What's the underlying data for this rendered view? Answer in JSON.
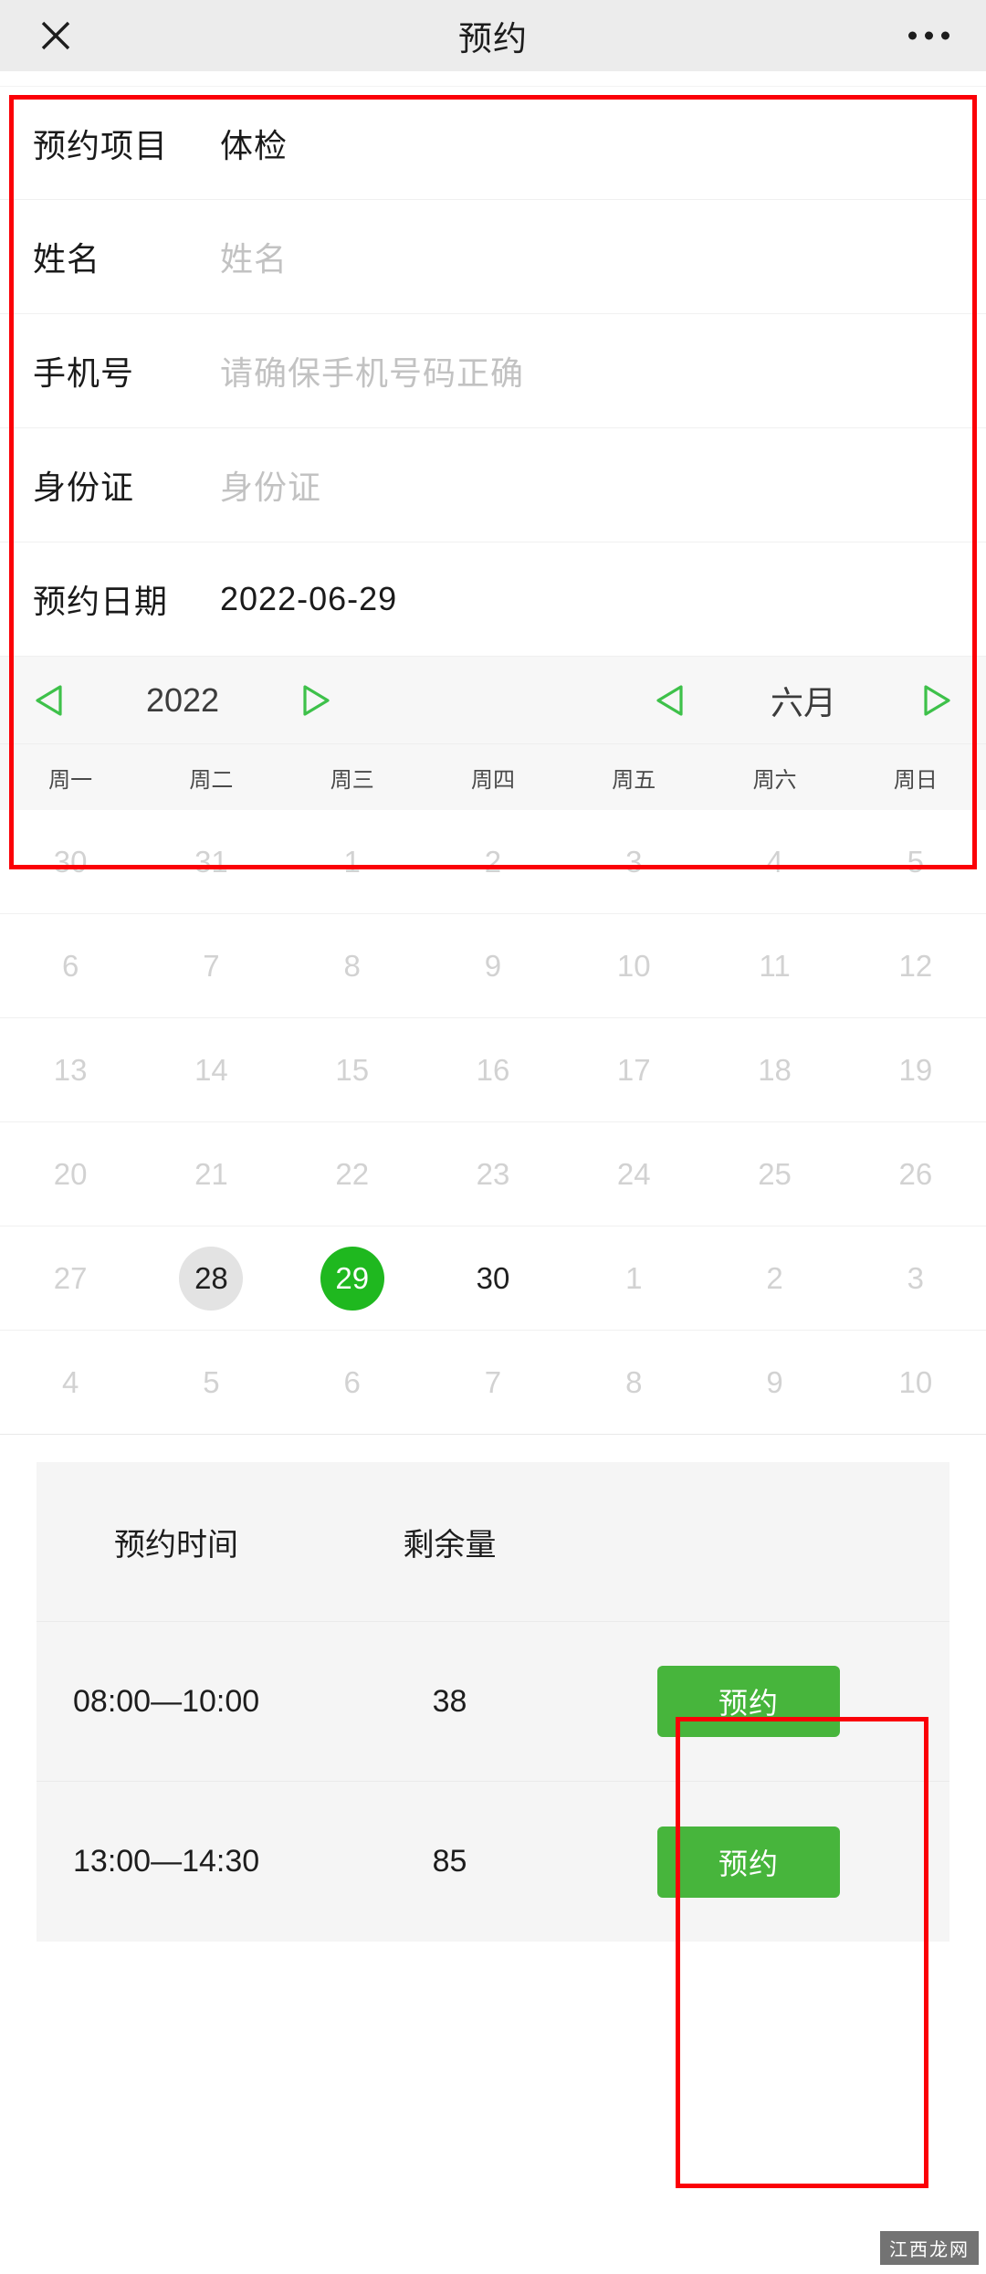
{
  "header": {
    "close_icon": "close-icon",
    "title": "预约",
    "more_icon": "more-dots-icon"
  },
  "form": {
    "rows": [
      {
        "label": "预约项目",
        "value": "体检",
        "is_placeholder": false
      },
      {
        "label": "姓名",
        "value": "姓名",
        "is_placeholder": true
      },
      {
        "label": "手机号",
        "value": "请确保手机号码正确",
        "is_placeholder": true
      },
      {
        "label": "身份证",
        "value": "身份证",
        "is_placeholder": true
      },
      {
        "label": "预约日期",
        "value": "2022-06-29",
        "is_placeholder": false
      }
    ]
  },
  "calendar": {
    "year": "2022",
    "month": "六月",
    "prev_year_icon": "triangle-left-icon",
    "next_year_icon": "triangle-right-icon",
    "prev_month_icon": "triangle-left-icon",
    "next_month_icon": "triangle-right-icon",
    "accent_color": "#3ec14a",
    "selected_color": "#1fb81f",
    "today_color": "#e3e3e3",
    "weekdays": [
      "周一",
      "周二",
      "周三",
      "周四",
      "周五",
      "周六",
      "周日"
    ],
    "weeks": [
      [
        {
          "d": "30",
          "state": "muted"
        },
        {
          "d": "31",
          "state": "muted"
        },
        {
          "d": "1",
          "state": "muted"
        },
        {
          "d": "2",
          "state": "muted"
        },
        {
          "d": "3",
          "state": "muted"
        },
        {
          "d": "4",
          "state": "muted"
        },
        {
          "d": "5",
          "state": "muted"
        }
      ],
      [
        {
          "d": "6",
          "state": "muted"
        },
        {
          "d": "7",
          "state": "muted"
        },
        {
          "d": "8",
          "state": "muted"
        },
        {
          "d": "9",
          "state": "muted"
        },
        {
          "d": "10",
          "state": "muted"
        },
        {
          "d": "11",
          "state": "muted"
        },
        {
          "d": "12",
          "state": "muted"
        }
      ],
      [
        {
          "d": "13",
          "state": "muted"
        },
        {
          "d": "14",
          "state": "muted"
        },
        {
          "d": "15",
          "state": "muted"
        },
        {
          "d": "16",
          "state": "muted"
        },
        {
          "d": "17",
          "state": "muted"
        },
        {
          "d": "18",
          "state": "muted"
        },
        {
          "d": "19",
          "state": "muted"
        }
      ],
      [
        {
          "d": "20",
          "state": "muted"
        },
        {
          "d": "21",
          "state": "muted"
        },
        {
          "d": "22",
          "state": "muted"
        },
        {
          "d": "23",
          "state": "muted"
        },
        {
          "d": "24",
          "state": "muted"
        },
        {
          "d": "25",
          "state": "muted"
        },
        {
          "d": "26",
          "state": "muted"
        }
      ],
      [
        {
          "d": "27",
          "state": "muted"
        },
        {
          "d": "28",
          "state": "today"
        },
        {
          "d": "29",
          "state": "selected"
        },
        {
          "d": "30",
          "state": "normal"
        },
        {
          "d": "1",
          "state": "muted"
        },
        {
          "d": "2",
          "state": "muted"
        },
        {
          "d": "3",
          "state": "muted"
        }
      ],
      [
        {
          "d": "4",
          "state": "muted"
        },
        {
          "d": "5",
          "state": "muted"
        },
        {
          "d": "6",
          "state": "muted"
        },
        {
          "d": "7",
          "state": "muted"
        },
        {
          "d": "8",
          "state": "muted"
        },
        {
          "d": "9",
          "state": "muted"
        },
        {
          "d": "10",
          "state": "muted"
        }
      ]
    ]
  },
  "slots": {
    "columns": [
      "预约时间",
      "剩余量"
    ],
    "rows": [
      {
        "time": "08:00—10:00",
        "remaining": "38",
        "button": "预约"
      },
      {
        "time": "13:00—14:30",
        "remaining": "85",
        "button": "预约"
      }
    ]
  },
  "watermark": {
    "text": "江西龙网"
  }
}
